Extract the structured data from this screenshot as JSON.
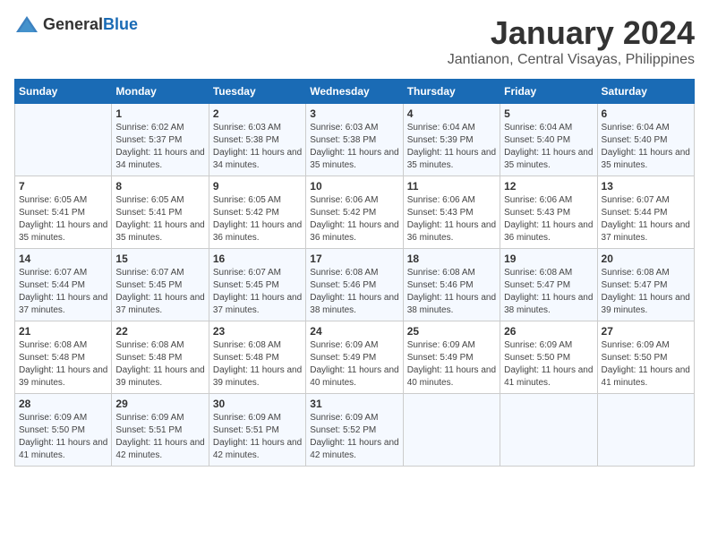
{
  "header": {
    "logo_general": "General",
    "logo_blue": "Blue",
    "month_title": "January 2024",
    "location": "Jantianon, Central Visayas, Philippines"
  },
  "days_of_week": [
    "Sunday",
    "Monday",
    "Tuesday",
    "Wednesday",
    "Thursday",
    "Friday",
    "Saturday"
  ],
  "weeks": [
    [
      {
        "day": "",
        "info": ""
      },
      {
        "day": "1",
        "info": "Sunrise: 6:02 AM\nSunset: 5:37 PM\nDaylight: 11 hours\nand 34 minutes."
      },
      {
        "day": "2",
        "info": "Sunrise: 6:03 AM\nSunset: 5:38 PM\nDaylight: 11 hours\nand 34 minutes."
      },
      {
        "day": "3",
        "info": "Sunrise: 6:03 AM\nSunset: 5:38 PM\nDaylight: 11 hours\nand 35 minutes."
      },
      {
        "day": "4",
        "info": "Sunrise: 6:04 AM\nSunset: 5:39 PM\nDaylight: 11 hours\nand 35 minutes."
      },
      {
        "day": "5",
        "info": "Sunrise: 6:04 AM\nSunset: 5:40 PM\nDaylight: 11 hours\nand 35 minutes."
      },
      {
        "day": "6",
        "info": "Sunrise: 6:04 AM\nSunset: 5:40 PM\nDaylight: 11 hours\nand 35 minutes."
      }
    ],
    [
      {
        "day": "7",
        "info": "Sunrise: 6:05 AM\nSunset: 5:41 PM\nDaylight: 11 hours\nand 35 minutes."
      },
      {
        "day": "8",
        "info": "Sunrise: 6:05 AM\nSunset: 5:41 PM\nDaylight: 11 hours\nand 35 minutes."
      },
      {
        "day": "9",
        "info": "Sunrise: 6:05 AM\nSunset: 5:42 PM\nDaylight: 11 hours\nand 36 minutes."
      },
      {
        "day": "10",
        "info": "Sunrise: 6:06 AM\nSunset: 5:42 PM\nDaylight: 11 hours\nand 36 minutes."
      },
      {
        "day": "11",
        "info": "Sunrise: 6:06 AM\nSunset: 5:43 PM\nDaylight: 11 hours\nand 36 minutes."
      },
      {
        "day": "12",
        "info": "Sunrise: 6:06 AM\nSunset: 5:43 PM\nDaylight: 11 hours\nand 36 minutes."
      },
      {
        "day": "13",
        "info": "Sunrise: 6:07 AM\nSunset: 5:44 PM\nDaylight: 11 hours\nand 37 minutes."
      }
    ],
    [
      {
        "day": "14",
        "info": "Sunrise: 6:07 AM\nSunset: 5:44 PM\nDaylight: 11 hours\nand 37 minutes."
      },
      {
        "day": "15",
        "info": "Sunrise: 6:07 AM\nSunset: 5:45 PM\nDaylight: 11 hours\nand 37 minutes."
      },
      {
        "day": "16",
        "info": "Sunrise: 6:07 AM\nSunset: 5:45 PM\nDaylight: 11 hours\nand 37 minutes."
      },
      {
        "day": "17",
        "info": "Sunrise: 6:08 AM\nSunset: 5:46 PM\nDaylight: 11 hours\nand 38 minutes."
      },
      {
        "day": "18",
        "info": "Sunrise: 6:08 AM\nSunset: 5:46 PM\nDaylight: 11 hours\nand 38 minutes."
      },
      {
        "day": "19",
        "info": "Sunrise: 6:08 AM\nSunset: 5:47 PM\nDaylight: 11 hours\nand 38 minutes."
      },
      {
        "day": "20",
        "info": "Sunrise: 6:08 AM\nSunset: 5:47 PM\nDaylight: 11 hours\nand 39 minutes."
      }
    ],
    [
      {
        "day": "21",
        "info": "Sunrise: 6:08 AM\nSunset: 5:48 PM\nDaylight: 11 hours\nand 39 minutes."
      },
      {
        "day": "22",
        "info": "Sunrise: 6:08 AM\nSunset: 5:48 PM\nDaylight: 11 hours\nand 39 minutes."
      },
      {
        "day": "23",
        "info": "Sunrise: 6:08 AM\nSunset: 5:48 PM\nDaylight: 11 hours\nand 39 minutes."
      },
      {
        "day": "24",
        "info": "Sunrise: 6:09 AM\nSunset: 5:49 PM\nDaylight: 11 hours\nand 40 minutes."
      },
      {
        "day": "25",
        "info": "Sunrise: 6:09 AM\nSunset: 5:49 PM\nDaylight: 11 hours\nand 40 minutes."
      },
      {
        "day": "26",
        "info": "Sunrise: 6:09 AM\nSunset: 5:50 PM\nDaylight: 11 hours\nand 41 minutes."
      },
      {
        "day": "27",
        "info": "Sunrise: 6:09 AM\nSunset: 5:50 PM\nDaylight: 11 hours\nand 41 minutes."
      }
    ],
    [
      {
        "day": "28",
        "info": "Sunrise: 6:09 AM\nSunset: 5:50 PM\nDaylight: 11 hours\nand 41 minutes."
      },
      {
        "day": "29",
        "info": "Sunrise: 6:09 AM\nSunset: 5:51 PM\nDaylight: 11 hours\nand 42 minutes."
      },
      {
        "day": "30",
        "info": "Sunrise: 6:09 AM\nSunset: 5:51 PM\nDaylight: 11 hours\nand 42 minutes."
      },
      {
        "day": "31",
        "info": "Sunrise: 6:09 AM\nSunset: 5:52 PM\nDaylight: 11 hours\nand 42 minutes."
      },
      {
        "day": "",
        "info": ""
      },
      {
        "day": "",
        "info": ""
      },
      {
        "day": "",
        "info": ""
      }
    ]
  ]
}
